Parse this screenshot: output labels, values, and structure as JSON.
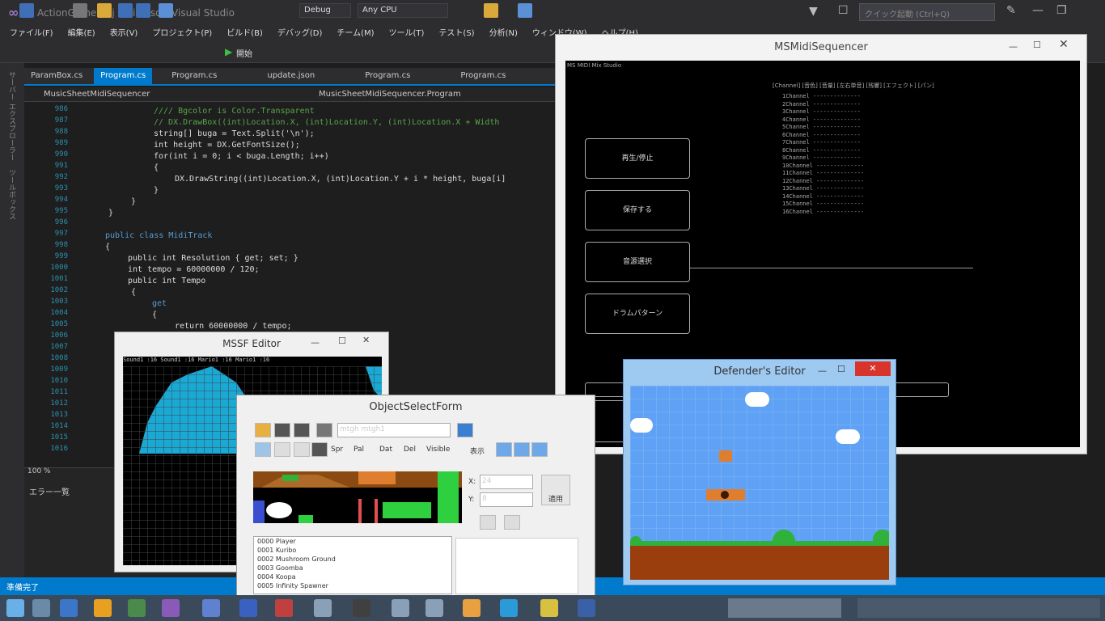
{
  "vs": {
    "title": "ActionGameProj - Microsoft Visual Studio",
    "search_placeholder": "クイック起動 (Ctrl+Q)",
    "menu": [
      "ファイル(F)",
      "編集(E)",
      "表示(V)",
      "プロジェクト(P)",
      "ビルド(B)",
      "デバッグ(D)",
      "チーム(M)",
      "ツール(T)",
      "テスト(S)",
      "分析(N)",
      "ウィンドウ(W)",
      "ヘルプ(H)"
    ],
    "toolbar": {
      "start": "開始",
      "config": "Debug",
      "platform": "Any CPU"
    },
    "tabs": [
      "ParamBox.cs",
      "Program.cs",
      "Program.cs",
      "update.json",
      "Program.cs",
      "Program.cs"
    ],
    "active_tab_index": 1,
    "nav_left": "MusicSheetMidiSequencer",
    "nav_right": "MusicSheetMidiSequencer.Program",
    "line_numbers": [
      "986",
      "987",
      "988",
      "989",
      "990",
      "991",
      "992",
      "993",
      "994",
      "995",
      "996",
      "997",
      "998",
      "999",
      "1000",
      "1001",
      "1002",
      "1003",
      "1004",
      "1005",
      "1006",
      "1007",
      "1008",
      "1009",
      "1010",
      "1011",
      "1012",
      "1013",
      "1014",
      "1015",
      "1016"
    ],
    "code": [
      {
        "cls": "cm",
        "text": "//// Bgcolor is Color.Transparent"
      },
      {
        "cls": "cm",
        "text": "// DX.DrawBox((int)Location.X, (int)Location.Y, (int)Location.X + Width"
      },
      {
        "cls": "tx",
        "text": "string[] buga = Text.Split('\\n');"
      },
      {
        "cls": "tx",
        "text": "int height = DX.GetFontSize();"
      },
      {
        "cls": "tx",
        "text": "for(int i = 0; i < buga.Length; i++)"
      },
      {
        "cls": "tx",
        "text": "{"
      },
      {
        "cls": "tx",
        "text": "    DX.DrawString((int)Location.X, (int)Location.Y + i * height, buga[i]"
      },
      {
        "cls": "tx",
        "text": "}"
      },
      {
        "cls": "tx",
        "text": "}"
      },
      {
        "cls": "tx",
        "text": "}"
      },
      {
        "cls": "tx",
        "text": ""
      },
      {
        "cls": "kw",
        "text": "public class MidiTrack"
      },
      {
        "cls": "tx",
        "text": "{"
      },
      {
        "cls": "tx",
        "text": "    public int Resolution { get; set; }"
      },
      {
        "cls": "tx",
        "text": "    int tempo = 60000000 / 120;"
      },
      {
        "cls": "tx",
        "text": "    public int Tempo"
      },
      {
        "cls": "tx",
        "text": "    {"
      },
      {
        "cls": "kw",
        "text": "        get"
      },
      {
        "cls": "tx",
        "text": "        {"
      },
      {
        "cls": "tx",
        "text": "            return 60000000 / tempo;"
      }
    ],
    "error_panel_title": "エラー一覧",
    "zoom": "100 %",
    "status": "準備完了"
  },
  "midi": {
    "title": "MSMidiSequencer",
    "header_text": "MS MIDI Mix Studio",
    "channel_header": "[Channel] [音色] [音量] [左右単音] [残響] [エフェクト] [パン]",
    "buttons": [
      "再生/停止",
      "保存する",
      "音源選択",
      "ドラムパターン"
    ],
    "channels": [
      "1Channel",
      "2Channel",
      "3Channel",
      "4Channel",
      "5Channel",
      "6Channel",
      "7Channel",
      "8Channel",
      "9Channel",
      "10Channel",
      "11Channel",
      "12Channel",
      "13Channel",
      "14Channel",
      "15Channel",
      "16Channel"
    ],
    "channel_value": "--------------"
  },
  "mssf": {
    "title": "MSSF Editor",
    "header": "Sound1 :16  Sound1 :16  Mario1 :16  Mario1 :16"
  },
  "objsel": {
    "title": "ObjectSelectForm",
    "field1": "mtgh",
    "field2": "mtgh1",
    "tools": [
      "Spr",
      "Pal",
      "Dat",
      "Del",
      "Visible",
      "表示"
    ],
    "x_label": "X:",
    "x_value": "24",
    "y_label": "Y:",
    "y_value": "8",
    "apply_label": "適用",
    "list": [
      "0000 Player",
      "0001 Kuribo",
      "0002 Mushroom Ground",
      "0003 Goomba",
      "0004 Koopa",
      "0005 Infinity Spawner"
    ]
  },
  "defender": {
    "title": "Defender's Editor"
  },
  "colors": {
    "vs_accent": "#007acc",
    "mssf_cyan": "#19a9d4",
    "defender_sky": "#5fa1f4",
    "ground": "#9a3e0d",
    "grass": "#2fb13c",
    "brick": "#e07e30"
  }
}
